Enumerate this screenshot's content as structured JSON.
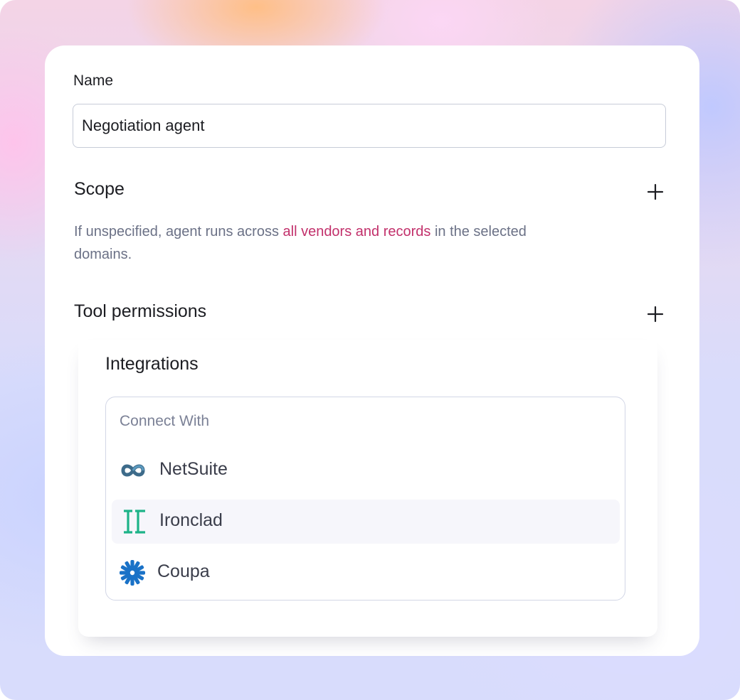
{
  "form": {
    "name_label": "Name",
    "name_value": "Negotiation agent"
  },
  "scope": {
    "title": "Scope",
    "description_prefix": "If unspecified, agent runs across ",
    "description_highlight": "all vendors and records",
    "description_suffix": " in the selected domains.",
    "highlight_color": "#c2306b"
  },
  "tool_permissions": {
    "title": "Tool permissions"
  },
  "integrations": {
    "title": "Integrations",
    "connect_label": "Connect With",
    "options": [
      {
        "label": "NetSuite",
        "icon": "netsuite-logo-icon"
      },
      {
        "label": "Ironclad",
        "icon": "ironclad-logo-icon"
      },
      {
        "label": "Coupa",
        "icon": "coupa-logo-icon"
      }
    ]
  }
}
